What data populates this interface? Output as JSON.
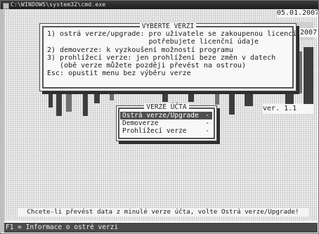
{
  "window": {
    "title": "C:\\WINDOWS\\system32\\cmd.exe"
  },
  "header": {
    "date": "05.01.2007",
    "year_fragment": ".2007",
    "version": "ver. 1.1"
  },
  "dialog": {
    "title": "VYBERTE VERZI",
    "lines": [
      "1) ostrá verze/upgrade: pro uživatele se zakoupenou licencí,",
      "                        potřebujete licenční údaje",
      "2) demoverze: k vyzkoušení možností programu",
      "3) prohlížecí verze: jen prohlížení beze změn v datech",
      "   (obě verze můžete později převést na ostrou)",
      "Esc: opustit menu bez výběru verze"
    ]
  },
  "menu": {
    "title": "VERZE ÚČTA",
    "items": [
      {
        "label": "Ostrá verze/Upgrade",
        "suffix": "-",
        "selected": true
      },
      {
        "label": "Demoverze",
        "suffix": "-",
        "selected": false
      },
      {
        "label": "Prohlížecí verze",
        "suffix": "-",
        "selected": false
      }
    ]
  },
  "hint": "Chcete-li převést data z minulé verze účta, volte Ostrá verze/Upgrade!",
  "status": "F1 = Informace o ostré verzi"
}
